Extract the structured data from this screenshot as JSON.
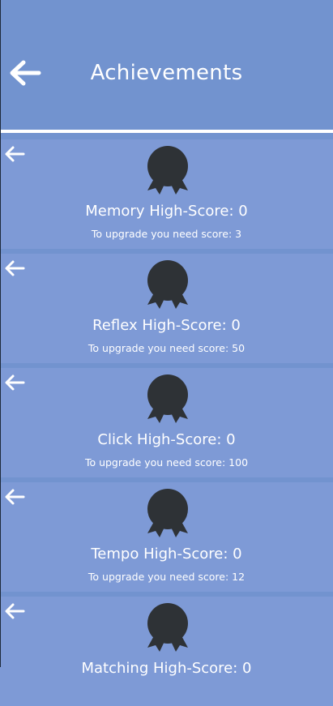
{
  "header": {
    "title": "Achievements",
    "back_icon": "arrow-left-icon"
  },
  "colors": {
    "background": "#7293cf",
    "card": "#7e9ad6",
    "badge": "#2e3236",
    "text": "#ffffff"
  },
  "achievements": [
    {
      "score_label": "Memory High-Score: 0",
      "requirement": "To upgrade you need score: 3"
    },
    {
      "score_label": "Reflex High-Score: 0",
      "requirement": "To upgrade you need score: 50"
    },
    {
      "score_label": "Click High-Score: 0",
      "requirement": "To upgrade you need score: 100"
    },
    {
      "score_label": "Tempo High-Score: 0",
      "requirement": "To upgrade you need score: 12"
    },
    {
      "score_label": "Matching High-Score: 0",
      "requirement": ""
    }
  ]
}
